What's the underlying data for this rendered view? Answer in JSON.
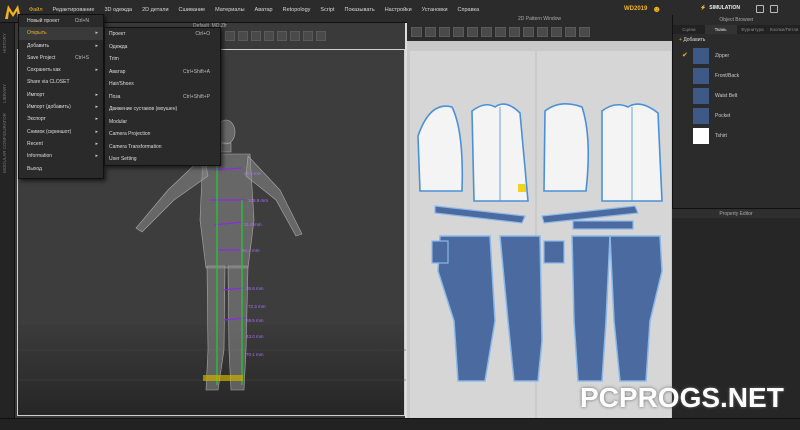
{
  "app": {
    "brand_color": "#f2b31f",
    "version": "WD2019",
    "simulation_label": "SIMULATION"
  },
  "menubar": [
    {
      "label": "Файл",
      "active": true
    },
    {
      "label": "Редактирование"
    },
    {
      "label": "3D одежда"
    },
    {
      "label": "2D детали"
    },
    {
      "label": "Сшивание"
    },
    {
      "label": "Материалы"
    },
    {
      "label": "Аватар"
    },
    {
      "label": "Retopology"
    },
    {
      "label": "Script"
    },
    {
      "label": "Показывать"
    },
    {
      "label": "Настройки"
    },
    {
      "label": "Установки"
    },
    {
      "label": "Справка"
    }
  ],
  "left_strip": {
    "label_a": "HISTORY",
    "label_b": "MODULAR CONFIGURATOR",
    "label_c": "LIBRARY"
  },
  "window3d": {
    "title": "Default_MD.Zfr"
  },
  "window2d": {
    "title": "2D Pattern Window"
  },
  "file_menu": [
    {
      "label": "Новый проект",
      "shortcut": "Ctrl+N"
    },
    {
      "label": "Открыть",
      "arrow": "▸",
      "highlight": true
    },
    {
      "label": "Добавить",
      "arrow": "▸"
    },
    {
      "label": "Save Project",
      "shortcut": "Ctrl+S"
    },
    {
      "label": "Сохранить как",
      "arrow": "▸"
    },
    {
      "label": "Share via CLOSET"
    },
    {
      "label": "Импорт",
      "arrow": "▸"
    },
    {
      "label": "Импорт (добавить)",
      "arrow": "▸"
    },
    {
      "label": "Экспорт",
      "arrow": "▸"
    },
    {
      "label": "Снимок (скриншот)",
      "arrow": "▸"
    },
    {
      "label": "Recent",
      "arrow": "▸"
    },
    {
      "label": "Information",
      "arrow": "▸"
    },
    {
      "label": "Выход"
    }
  ],
  "open_submenu": [
    {
      "label": "Проект",
      "shortcut": "Ctrl+O"
    },
    {
      "label": "Одежда"
    },
    {
      "label": "Trim"
    },
    {
      "label": "Аватар",
      "shortcut": "Ctrl+Shift+A"
    },
    {
      "label": "Hair/Shoes"
    },
    {
      "label": "Поза",
      "shortcut": "Ctrl+Shift+P"
    },
    {
      "label": "Движение суставов (моушен)"
    },
    {
      "label": "Modular"
    },
    {
      "label": "Camera Projection"
    },
    {
      "label": "Camera Transformation"
    },
    {
      "label": "User Setting"
    }
  ],
  "object_browser": {
    "title": "Object Browser",
    "tabs": [
      "Сцена",
      "Ткань",
      "Фурнитура",
      "Кнопки/Петли"
    ],
    "active_tab": 1,
    "add_label": "Добавить",
    "fabrics": [
      {
        "label": "Zipper",
        "color": "#3d5a87",
        "checked": true
      },
      {
        "label": "Front/Back",
        "color": "#3d5a87"
      },
      {
        "label": "Waist Belt",
        "color": "#3d5a87"
      },
      {
        "label": "Pocket",
        "color": "#3d5a87"
      },
      {
        "label": "Tshirt",
        "color": "#ffffff"
      }
    ]
  },
  "property_editor": {
    "title": "Property Editor"
  },
  "measurements": [
    "42.4 mm",
    "108.9 mm",
    "31.8 mm",
    "94.1 mm",
    "35.6 mm",
    "72.3 mm",
    "69.5 mm",
    "43.0 mm",
    "70.1 mm"
  ],
  "watermark": "PCPROGS.NET"
}
